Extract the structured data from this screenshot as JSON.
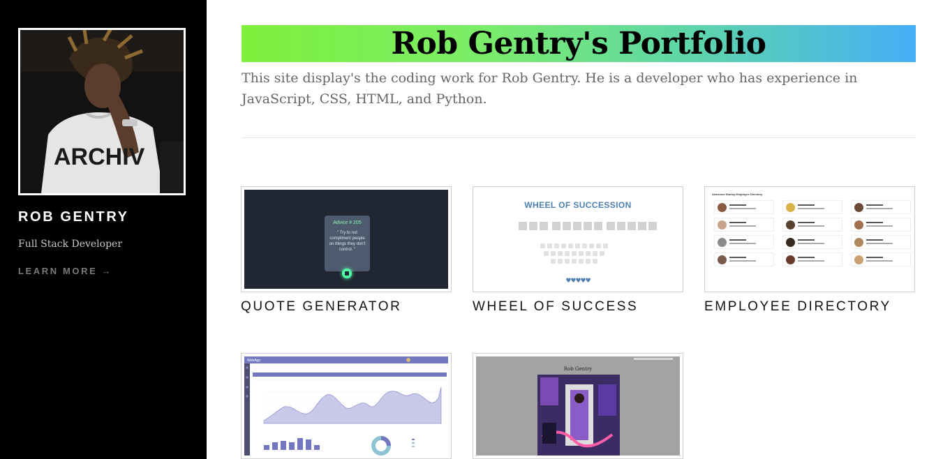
{
  "sidebar": {
    "name": "ROB GENTRY",
    "role": "Full Stack Developer",
    "learn_more": "LEARN MORE →",
    "avatar_shirt_text": "ARCHIV"
  },
  "header": {
    "title": "Rob Gentry's Portfolio",
    "intro": "This site display's the coding work for Rob Gentry. He is a developer who has experience in JavaScript, CSS, HTML, and Python."
  },
  "colors": {
    "sidebar_bg": "#000000",
    "banner_start": "#7ef03c",
    "banner_end": "#46aef7",
    "label_text": "#111111"
  },
  "projects": [
    {
      "label": "QUOTE GENERATOR",
      "thumb": {
        "advice_title": "Advice # 205",
        "quote": "\" Try to not compliment people on things they don't control. \""
      }
    },
    {
      "label": "WHEEL OF SUCCESS",
      "thumb": {
        "title": "WHEEL OF SUCCESSION",
        "hearts": "♥♥♥♥♥",
        "keys_row1": [
          "q",
          "w",
          "e",
          "r",
          "t",
          "y",
          "u",
          "i",
          "o",
          "p"
        ],
        "keys_row2": [
          "a",
          "s",
          "d",
          "f",
          "g",
          "h",
          "j",
          "k",
          "l"
        ],
        "keys_row3": [
          "z",
          "x",
          "c",
          "v",
          "b",
          "n",
          "m"
        ]
      }
    },
    {
      "label": "EMPLOYEE DIRECTORY",
      "thumb": {
        "title": "Awesome Startup Employee Directory"
      }
    },
    {
      "label": "",
      "thumb": {
        "app_name": "WebApp"
      }
    },
    {
      "label": "",
      "thumb": {
        "title": "Rob Gentry"
      }
    }
  ]
}
